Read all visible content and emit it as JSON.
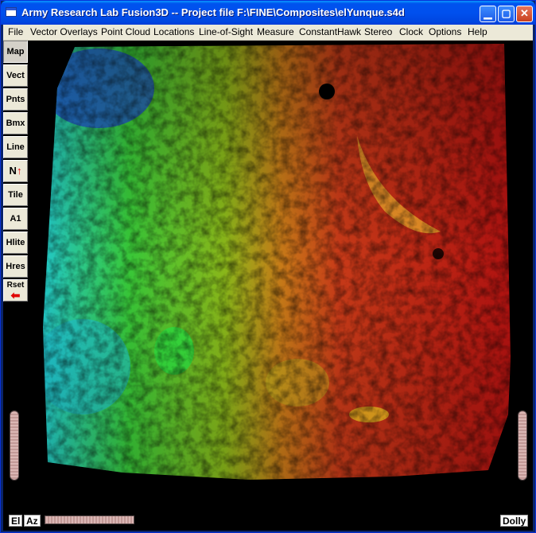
{
  "window": {
    "title": "Army Research Lab Fusion3D -- Project file F:\\FINE\\Composites\\elYunque.s4d",
    "minimize_icon": "minimize-icon",
    "maximize_icon": "maximize-icon",
    "close_icon": "close-icon"
  },
  "menu": [
    "File",
    "Vector Overlays",
    "Point Cloud",
    "Locations",
    "Line-of-Sight",
    "Measure",
    "ConstantHawk",
    "Stereo",
    "Clock",
    "Options",
    "Help"
  ],
  "toolbar": {
    "buttons": [
      "Map",
      "Vect",
      "Pnts",
      "Bmx",
      "Line",
      "N",
      "Tile",
      "A1",
      "Hlite",
      "Hres",
      "Rset"
    ],
    "north_arrow_icon": "north-arrow-icon",
    "reset_arrow_icon": "left-arrow-icon"
  },
  "view": {
    "el_label": "El",
    "az_label": "Az",
    "dolly_label": "Dolly"
  },
  "colors": {
    "title_bar": "#0054e3",
    "menu_bg": "#ece9d8",
    "canvas_bg": "#000000",
    "arrow_red": "#e00000"
  }
}
